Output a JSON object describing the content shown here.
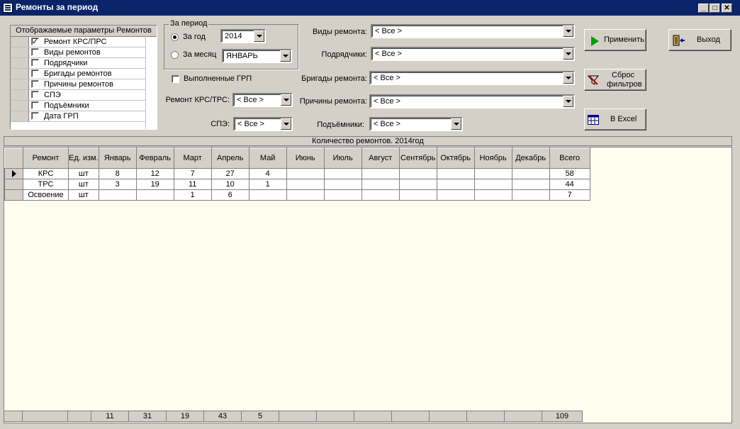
{
  "window": {
    "title": "Ремонты за период"
  },
  "params": {
    "header": "Отображаемые параметры Ремонтов",
    "items": [
      {
        "label": "Ремонт КРС/ПРС",
        "checked": "✓"
      },
      {
        "label": "Виды ремонтов",
        "checked": ""
      },
      {
        "label": "Подрядчики",
        "checked": ""
      },
      {
        "label": "Бригады ремонтов",
        "checked": ""
      },
      {
        "label": "Причины ремонтов",
        "checked": ""
      },
      {
        "label": "СПЭ",
        "checked": ""
      },
      {
        "label": "Подъёмники",
        "checked": ""
      },
      {
        "label": "Дата ГРП",
        "checked": ""
      }
    ]
  },
  "period": {
    "title": "За период",
    "year_label": "За год",
    "year_value": "2014",
    "month_label": "За месяц",
    "month_value": "ЯНВАРЬ"
  },
  "filters": {
    "grp_label": "Выполненные ГРП",
    "krs_label": "Ремонт КРС/ТРС:",
    "krs_value": "< Все >",
    "spe_label": "СПЭ:",
    "spe_value": "< Все >",
    "types_label": "Виды ремонта:",
    "types_value": "< Все >",
    "contractors_label": "Подрядчики:",
    "contractors_value": "< Все >",
    "brigades_label": "Бригады ремонта:",
    "brigades_value": "< Все >",
    "reasons_label": "Причины ремонта:",
    "reasons_value": "< Все >",
    "lifts_label": "Подъёмники:",
    "lifts_value": "< Все >"
  },
  "buttons": {
    "apply": "Применить",
    "exit": "Выход",
    "reset_line1": "Сброс",
    "reset_line2": "фильтров",
    "excel": "В Excel"
  },
  "grid": {
    "caption": "Количество ремонтов. 2014год",
    "headers": [
      "Ремонт",
      "Ед. изм.",
      "Январь",
      "Февраль",
      "Март",
      "Апрель",
      "Май",
      "Июнь",
      "Июль",
      "Август",
      "Сентябрь",
      "Октябрь",
      "Ноябрь",
      "Декабрь",
      "Всего"
    ],
    "rows": [
      [
        "КРС",
        "шт",
        "8",
        "12",
        "7",
        "27",
        "4",
        "",
        "",
        "",
        "",
        "",
        "",
        "",
        "58"
      ],
      [
        "ТРС",
        "шт",
        "3",
        "19",
        "11",
        "10",
        "1",
        "",
        "",
        "",
        "",
        "",
        "",
        "",
        "44"
      ],
      [
        "Освоение",
        "шт",
        "",
        "",
        "1",
        "6",
        "",
        "",
        "",
        "",
        "",
        "",
        "",
        "",
        "7"
      ]
    ],
    "totals": [
      "",
      "",
      "11",
      "31",
      "19",
      "43",
      "5",
      "",
      "",
      "",
      "",
      "",
      "",
      "",
      "109"
    ]
  },
  "colors": {
    "titlebar": "#0a246a",
    "panel": "#d4d0c8",
    "grid_background": "#fefeef"
  }
}
